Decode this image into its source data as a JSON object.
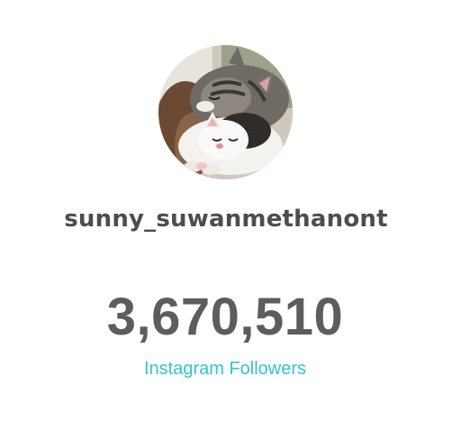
{
  "profile": {
    "username": "sunny_suwanmethanont",
    "avatar_icon": "profile-photo-kittens"
  },
  "stats": {
    "followers_count": "3,670,510",
    "followers_label": "Instagram Followers"
  },
  "colors": {
    "username": "#4d4d4d",
    "count": "#5d5d5d",
    "label_accent": "#35c3cf",
    "background": "#ffffff"
  }
}
